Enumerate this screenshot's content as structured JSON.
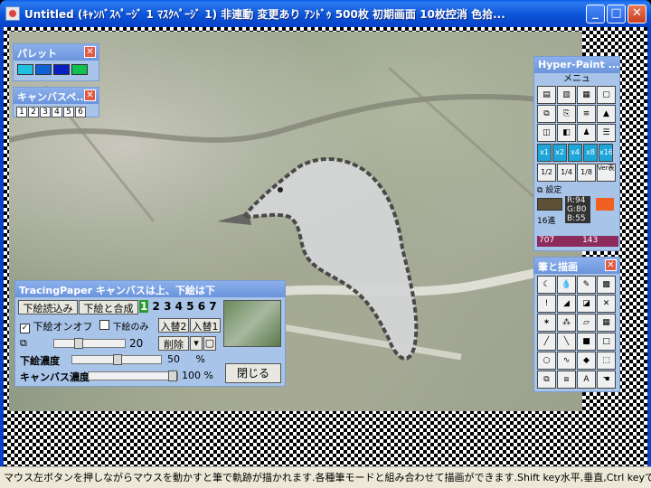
{
  "window": {
    "title": "Untitled (ｷｬﾝﾊﾞｽﾍﾟｰｼﾞ 1 ﾏｽｸﾍﾟｰｼﾞ 1) 非連動 変更あり ｱﾝﾄﾞｩ 500枚 初期画面 10枚控消 色拾...",
    "minimize": "_",
    "maximize": "□",
    "close": "✕"
  },
  "palette_panel": {
    "title": "パレット",
    "close": "✕",
    "colors": [
      "#20c0e0",
      "#1060d8",
      "#0820c0",
      "#10c050"
    ]
  },
  "canvas_pages_panel": {
    "title": "キャンバスペ...",
    "close": "✕",
    "pages": [
      "1",
      "2",
      "3",
      "4",
      "5",
      "6"
    ]
  },
  "hyper_paint": {
    "title": "Hyper-Paint ...",
    "menu_label": "メニュ",
    "zoom": [
      "x1",
      "x2",
      "x4",
      "x8",
      "x16"
    ],
    "fraction_left": "1/2",
    "fraction_mid": "1/4",
    "fraction_right": "1/8",
    "ver_label": "Ver表示",
    "settings_label": "設定",
    "rgb": {
      "r": "R:94",
      "g": "G:80",
      "b": "B:55"
    },
    "hex_label": "16進",
    "coord_x": "707",
    "coord_y": "143"
  },
  "brush_panel": {
    "title": "筆と描画",
    "close": "✕"
  },
  "tracing": {
    "title": "TracingPaper キャンバスは上、下絵は下",
    "load_label": "下絵読込み",
    "merge_label": "下絵と合成",
    "slots": [
      "1",
      "2",
      "3",
      "4",
      "5",
      "6",
      "7"
    ],
    "onoff_label": "下絵オンオフ",
    "only_label": "下絵のみ",
    "swap2_label": "入替2",
    "swap1_label": "入替1",
    "delete_label": "削除",
    "size_value": "20",
    "density_label": "下絵濃度",
    "density_value": "50",
    "canvas_density_label": "キャンバス濃度",
    "canvas_density_value": "100",
    "percent": "%",
    "close_label": "閉じる"
  },
  "status": {
    "text": "マウス左ボタンを押しながらマウスを動かすと筆で軌跡が描かれます.各種筆モードと組み合わせて描画ができます.Shift key水平,垂直,Ctrl keyで"
  }
}
